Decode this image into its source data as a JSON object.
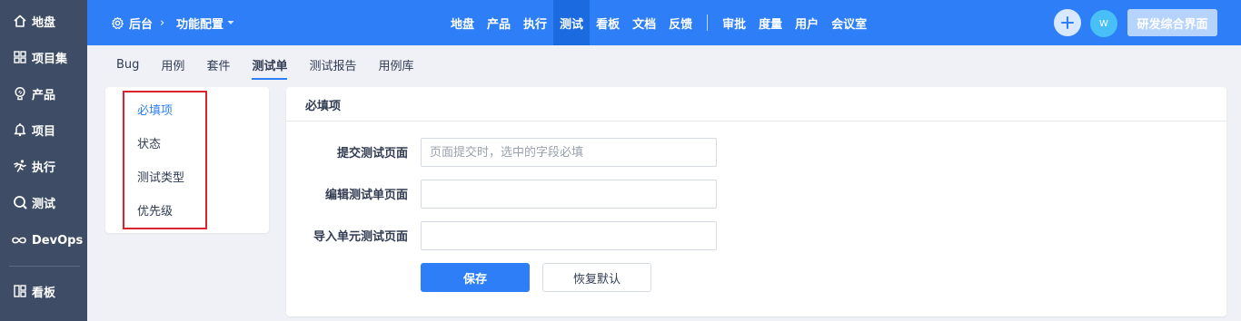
{
  "sidebar": {
    "items": [
      {
        "label": "地盘",
        "icon": "home-icon"
      },
      {
        "label": "项目集",
        "icon": "grid-icon"
      },
      {
        "label": "产品",
        "icon": "lightbulb-icon"
      },
      {
        "label": "项目",
        "icon": "project-bell-icon"
      },
      {
        "label": "执行",
        "icon": "run-icon"
      },
      {
        "label": "测试",
        "icon": "magnifier-icon"
      },
      {
        "label": "DevOps",
        "icon": "infinity-icon"
      },
      {
        "label": "看板",
        "icon": "kanban-icon"
      }
    ]
  },
  "header": {
    "home_label": "后台",
    "breadcrumb_sep": "›",
    "current_label": "功能配置",
    "nav": [
      "地盘",
      "产品",
      "执行",
      "测试",
      "看板",
      "文档",
      "反馈"
    ],
    "nav_active": "测试",
    "nav2": [
      "审批",
      "度量",
      "用户",
      "会议室"
    ],
    "avatar_text": "W",
    "product_button": "研发综合界面",
    "colors": {
      "bar": "#2e7ff7",
      "active": "#1c6ae0"
    }
  },
  "subtabs": {
    "items": [
      "Bug",
      "用例",
      "套件",
      "测试单",
      "测试报告",
      "用例库"
    ],
    "active": "测试单"
  },
  "config_menu": {
    "items": [
      "必填项",
      "状态",
      "测试类型",
      "优先级"
    ],
    "active": "必填项",
    "highlight_color": "#d9232d"
  },
  "main": {
    "title": "必填项",
    "rows": [
      {
        "label": "提交测试页面",
        "value": "",
        "placeholder": "页面提交时，选中的字段必填"
      },
      {
        "label": "编辑测试单页面",
        "value": "",
        "placeholder": ""
      },
      {
        "label": "导入单元测试页面",
        "value": "",
        "placeholder": ""
      }
    ],
    "save_label": "保存",
    "reset_label": "恢复默认"
  }
}
